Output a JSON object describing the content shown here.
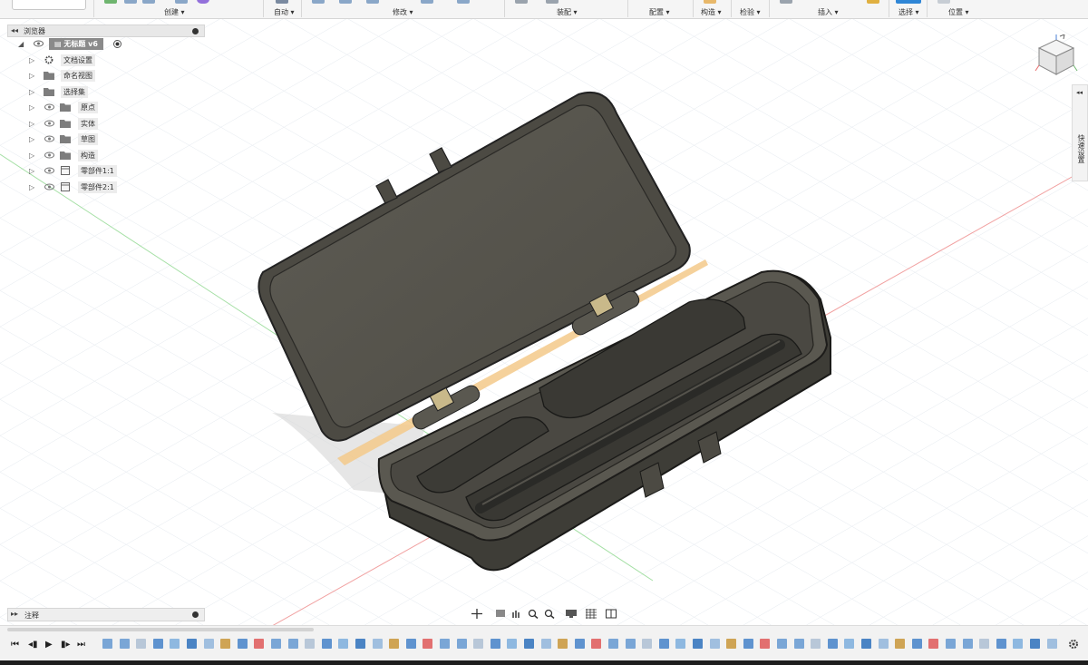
{
  "toolbar": {
    "groups": [
      "创建",
      "自动",
      "修改",
      "装配",
      "配置",
      "构造",
      "检验",
      "插入",
      "选择",
      "位置"
    ]
  },
  "browser": {
    "title": "浏览器",
    "root_label": "无标题 v6",
    "items": [
      {
        "label": "文档设置",
        "icon": "gear-icon",
        "eye": false
      },
      {
        "label": "命名视图",
        "icon": "folder-icon",
        "eye": false
      },
      {
        "label": "选择集",
        "icon": "folder-icon",
        "eye": false
      },
      {
        "label": "原点",
        "icon": "folder-icon",
        "eye": true
      },
      {
        "label": "实体",
        "icon": "folder-icon",
        "eye": true
      },
      {
        "label": "草图",
        "icon": "folder-icon",
        "eye": true
      },
      {
        "label": "构造",
        "icon": "folder-icon",
        "eye": true
      },
      {
        "label": "零部件1:1",
        "icon": "component-icon",
        "eye": true
      },
      {
        "label": "零部件2:1",
        "icon": "component-icon",
        "eye": true
      }
    ]
  },
  "quick_settings": {
    "label": "快速设置"
  },
  "annotation": {
    "title": "注释"
  },
  "colors": {
    "case_body": "#5c5a52",
    "case_dark": "#3a3934",
    "selection_plane": "#f3c98a",
    "grid": "#dfe6ee",
    "axis_x": "#e86a6a",
    "axis_y": "#7fd07f"
  }
}
